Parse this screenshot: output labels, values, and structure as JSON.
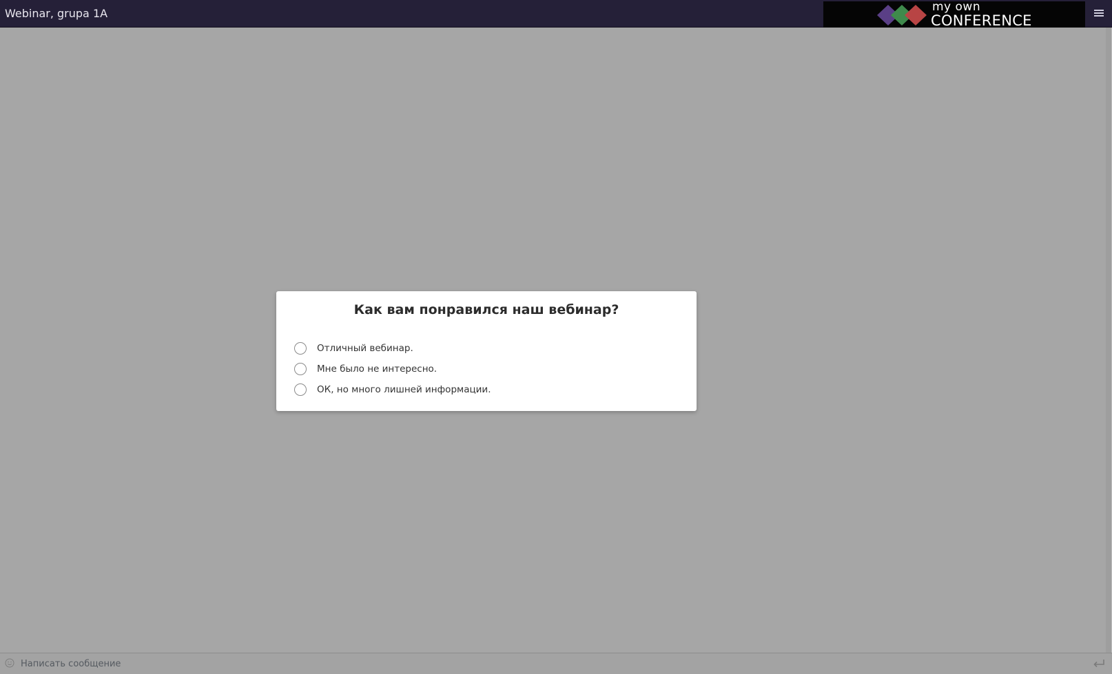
{
  "header": {
    "title": "Webinar, grupa 1A",
    "logo": {
      "line1": "my own",
      "line2": "CONFERENCE",
      "colors": [
        "#5a3f86",
        "#3f8a4c",
        "#b84444"
      ]
    },
    "menu_icon": "hamburger-menu-icon"
  },
  "poll": {
    "question": "Как вам понравился наш вебинар?",
    "options": [
      {
        "label": "Отличный вебинар."
      },
      {
        "label": "Мне было не интересно."
      },
      {
        "label": "ОК, но много лишней информации."
      }
    ]
  },
  "chat": {
    "placeholder": "Написать сообщение",
    "emoji_icon": "smile-icon",
    "send_icon": "enter-send-icon"
  },
  "colors": {
    "topbar": "#252038",
    "overlay": "#a6a6a6",
    "dialog": "#ffffff"
  }
}
